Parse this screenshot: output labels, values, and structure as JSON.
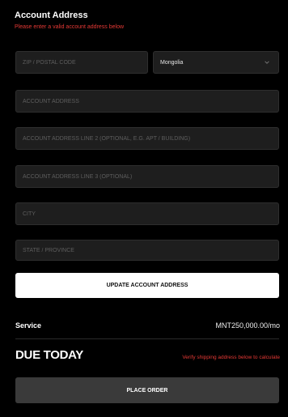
{
  "header": {
    "title": "Account Address",
    "error": "Please enter a valid account address below"
  },
  "form": {
    "zip_placeholder": "ZIP / POSTAL CODE",
    "country_value": "Mongolia",
    "address1_placeholder": "ACCOUNT ADDRESS",
    "address2_placeholder": "ACCOUNT ADDRESS LINE 2 (OPTIONAL, E.G. APT / BUILDING)",
    "address3_placeholder": "ACCOUNT ADDRESS LINE 3 (OPTIONAL)",
    "city_placeholder": "CITY",
    "state_placeholder": "STATE / PROVINCE",
    "update_button": "UPDATE ACCOUNT ADDRESS"
  },
  "summary": {
    "service_label": "Service",
    "service_price": "MNT250,000.00/mo",
    "due_label": "DUE TODAY",
    "due_note": "Verify shipping address below to calculate",
    "place_order_button": "PLACE ORDER"
  },
  "colors": {
    "background": "#000000",
    "field_bg": "#1e1e1e",
    "error_red": "#e53935"
  }
}
